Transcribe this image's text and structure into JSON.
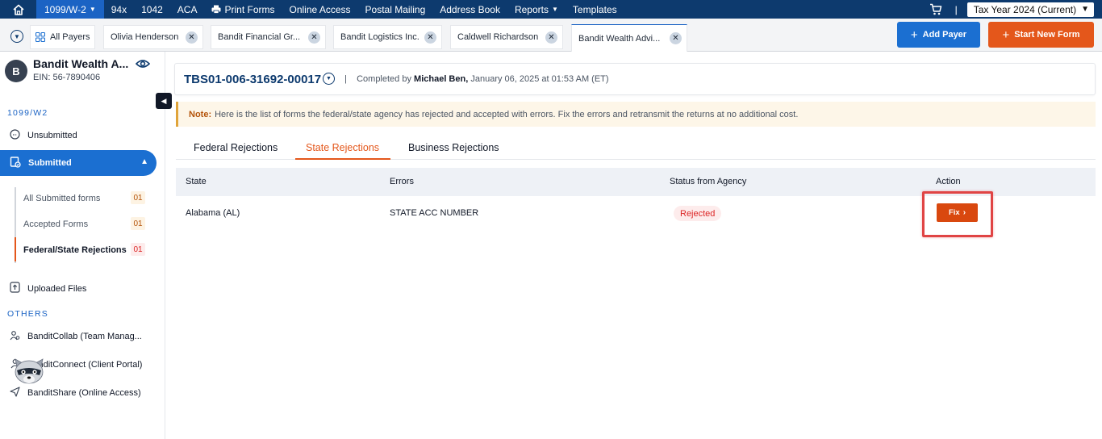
{
  "topnav": {
    "items": [
      {
        "label": "1099/W-2",
        "active": true,
        "dropdown": true
      },
      {
        "label": "94x"
      },
      {
        "label": "1042"
      },
      {
        "label": "ACA"
      },
      {
        "label": "Print Forms",
        "icon": "printer-icon"
      },
      {
        "label": "Online Access"
      },
      {
        "label": "Postal Mailing"
      },
      {
        "label": "Address Book"
      },
      {
        "label": "Reports",
        "dropdown": true
      },
      {
        "label": "Templates"
      }
    ],
    "separator": "|",
    "tax_year": "Tax Year 2024 (Current)"
  },
  "tabs": {
    "all_payers": "All Payers",
    "payers": [
      "Olivia Henderson",
      "Bandit Financial Gr...",
      "Bandit Logistics Inc.",
      "Caldwell Richardson",
      "Bandit Wealth Advi..."
    ],
    "active_index": 4,
    "add_payer": "Add Payer",
    "start_new_form": "Start New Form"
  },
  "sidebar": {
    "avatar_initial": "B",
    "payer_name": "Bandit Wealth A...",
    "ein": "EIN: 56-7890406",
    "section_1099": "1099/W2",
    "unsubmitted": "Unsubmitted",
    "submitted": "Submitted",
    "sub_items": [
      {
        "label": "All Submitted forms",
        "count": "01"
      },
      {
        "label": "Accepted Forms",
        "count": "01"
      },
      {
        "label": "Federal/State Rejections",
        "count": "01",
        "active": true
      }
    ],
    "uploaded_files": "Uploaded Files",
    "section_others": "OTHERS",
    "others": [
      {
        "label": "BanditCollab (Team Manag..."
      },
      {
        "label": "BanditConnect (Client Portal)"
      },
      {
        "label": "BanditShare (Online Access)"
      }
    ]
  },
  "main": {
    "form_id": "TBS01-006-31692-00017",
    "separator": "|",
    "completed_prefix": "Completed by",
    "completed_by": "Michael Ben,",
    "completed_date": "January 06, 2025 at 01:53 AM (ET)",
    "note_label": "Note:",
    "note_text": "Here is the list of forms the federal/state agency has rejected and accepted with errors. Fix the errors and retransmit the returns at no additional cost.",
    "subtabs": [
      "Federal Rejections",
      "State Rejections",
      "Business Rejections"
    ],
    "active_subtab": 1,
    "table": {
      "headers": [
        "State",
        "Errors",
        "Status from Agency",
        "Action"
      ],
      "rows": [
        {
          "state": "Alabama (AL)",
          "errors": "STATE ACC NUMBER",
          "status": "Rejected",
          "action": "Fix"
        }
      ]
    }
  },
  "colors": {
    "nav_bg": "#0d3a6e",
    "primary": "#1b6fd1",
    "accent": "#e4571b",
    "rejected": "#dc2626",
    "highlight": "#e04444"
  }
}
